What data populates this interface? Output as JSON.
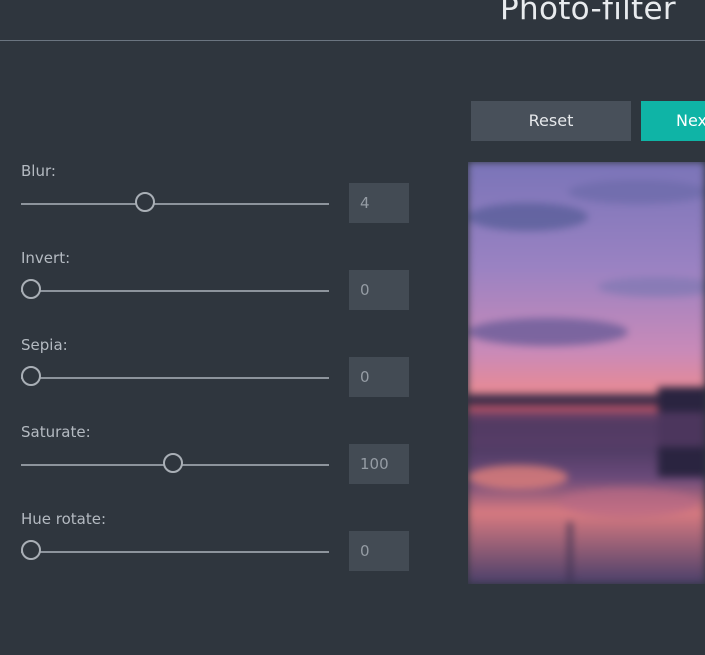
{
  "header": {
    "title": "Photo-filter"
  },
  "buttons": {
    "reset": "Reset",
    "next": "Next"
  },
  "controls": [
    {
      "label": "Blur:",
      "value": "4",
      "min": 0,
      "max": 10
    },
    {
      "label": "Invert:",
      "value": "0",
      "min": 0,
      "max": 100
    },
    {
      "label": "Sepia:",
      "value": "0",
      "min": 0,
      "max": 100
    },
    {
      "label": "Saturate:",
      "value": "100",
      "min": 0,
      "max": 200
    },
    {
      "label": "Hue rotate:",
      "value": "0",
      "min": 0,
      "max": 360
    }
  ],
  "colors": {
    "background": "#2f363e",
    "accent": "#0fb4a6",
    "field": "#434b54"
  }
}
